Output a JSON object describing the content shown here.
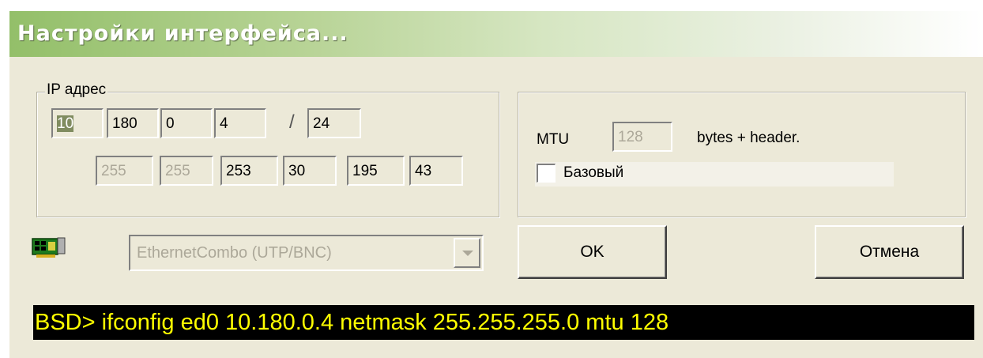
{
  "window": {
    "title": "Настройки интерфейса..."
  },
  "ip_group": {
    "label": "IP адрес",
    "octets": [
      "10",
      "180",
      "0",
      "4"
    ],
    "separator": "/",
    "prefix": "24",
    "mask_fields": [
      "255",
      "255",
      "253",
      "30",
      "195",
      "43"
    ]
  },
  "mtu_group": {
    "mtu_label": "MTU",
    "mtu_value": "128",
    "mtu_suffix": "bytes + header.",
    "base_checkbox_label": "Базовый",
    "base_checked": false
  },
  "adapter": {
    "icon": "network-card-icon",
    "selected": "EthernetCombo (UTP/BNC)"
  },
  "buttons": {
    "ok": "OK",
    "cancel": "Отмена"
  },
  "console": {
    "text": "BSD> ifconfig ed0 10.180.0.4 netmask 255.255.255.0 mtu 128"
  },
  "colors": {
    "console_bg": "#000000",
    "console_text": "#ffff00",
    "dialog_bg": "#ece9d8"
  }
}
